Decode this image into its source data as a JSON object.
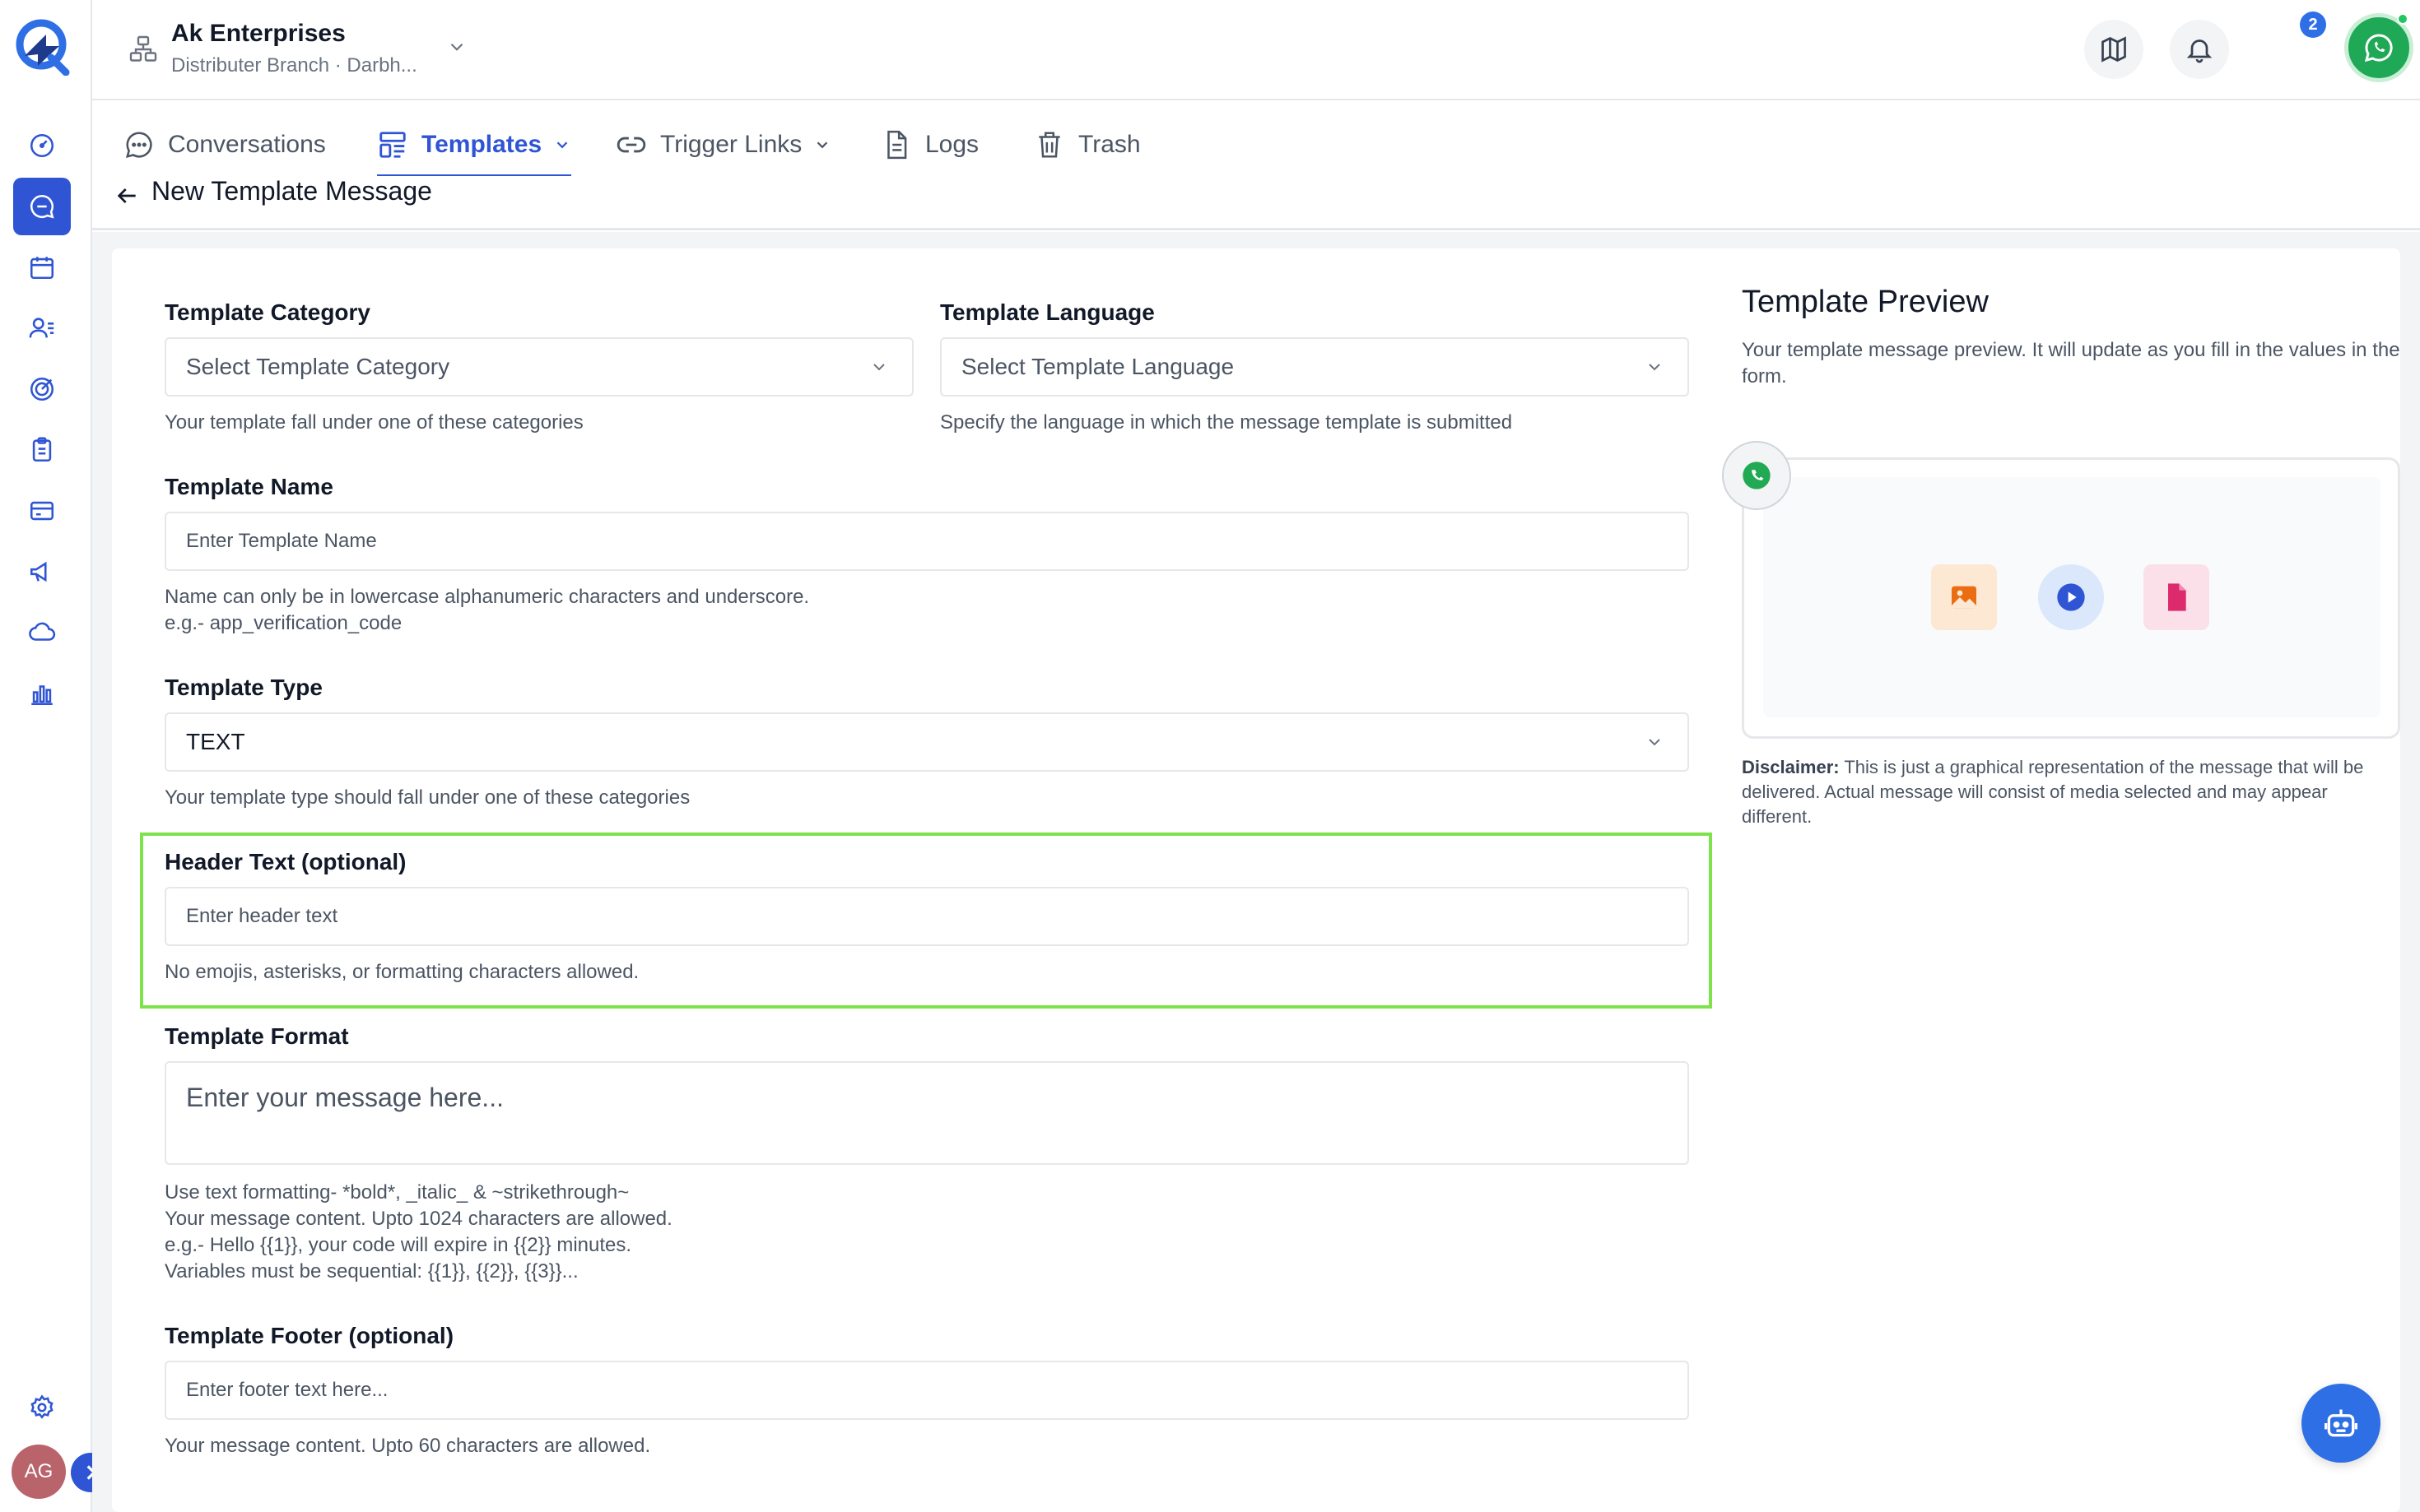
{
  "org": {
    "name": "Ak Enterprises",
    "subtitle": "Distributer Branch · Darbh..."
  },
  "user": {
    "initials": "AG"
  },
  "notifications": {
    "count": "2"
  },
  "colors": {
    "accent": "#2f55d4",
    "whatsapp": "#1fa855",
    "highlight": "#7ee24b",
    "avatar": "#b9646b"
  },
  "tabs": [
    {
      "label": "Conversations",
      "icon": "chat-icon"
    },
    {
      "label": "Templates",
      "icon": "template-icon",
      "active": true
    },
    {
      "label": "Trigger Links",
      "icon": "link-icon"
    },
    {
      "label": "Logs",
      "icon": "document-icon"
    },
    {
      "label": "Trash",
      "icon": "trash-icon"
    }
  ],
  "page": {
    "title": "New Template Message"
  },
  "form": {
    "category": {
      "label": "Template Category",
      "placeholder": "Select Template Category",
      "help": "Your template fall under one of these categories"
    },
    "language": {
      "label": "Template Language",
      "placeholder": "Select Template Language",
      "help": "Specify the language in which the message template is submitted"
    },
    "name": {
      "label": "Template Name",
      "placeholder": "Enter Template Name",
      "help1": "Name can only be in lowercase alphanumeric characters and underscore.",
      "help2": "e.g.- app_verification_code"
    },
    "type": {
      "label": "Template Type",
      "value": "TEXT",
      "help": "Your template type should fall under one of these categories"
    },
    "header": {
      "label": "Header Text (optional)",
      "placeholder": "Enter header text",
      "help": "No emojis, asterisks, or formatting characters allowed."
    },
    "format": {
      "label": "Template Format",
      "placeholder": "Enter your message here...",
      "help1": "Use text formatting- *bold*, _italic_ & ~strikethrough~",
      "help2": "Your message content. Upto 1024 characters are allowed.",
      "help3": "e.g.- Hello {{1}}, your code will expire in {{2}} minutes.",
      "help4": "Variables must be sequential: {{1}}, {{2}}, {{3}}..."
    },
    "footer": {
      "label": "Template Footer (optional)",
      "placeholder": "Enter footer text here...",
      "help": "Your message content. Upto 60 characters are allowed."
    }
  },
  "preview": {
    "title": "Template Preview",
    "description": "Your template message preview. It will update as you fill in the values in the form.",
    "disclaimer_label": "Disclaimer:",
    "disclaimer_text": " This is just a graphical representation of the message that will be delivered. Actual message will consist of media selected and may appear different."
  }
}
